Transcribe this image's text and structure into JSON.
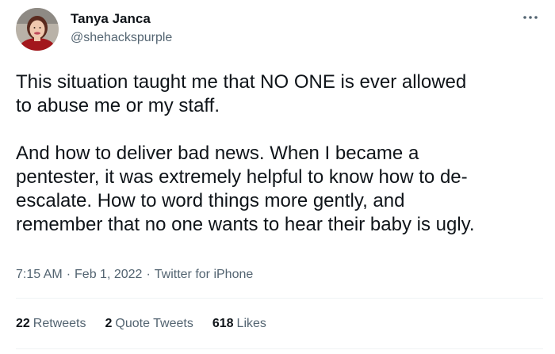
{
  "user": {
    "name": "Tanya Janca",
    "handle": "@shehackspurple"
  },
  "tweet": {
    "paragraphs": [
      [
        "This situation taught me that NO ONE is ever allowed",
        "to abuse me or my staff."
      ],
      [
        "And how to deliver bad news. When I became a",
        "pentester, it was extremely helpful to know how to de-",
        "escalate. How to word things more gently, and",
        "remember that no one wants to hear their baby is ugly."
      ]
    ]
  },
  "meta": {
    "time": "7:15 AM",
    "date": "Feb 1, 2022",
    "source": "Twitter for iPhone",
    "separator": "·"
  },
  "stats": {
    "retweets_count": "22",
    "retweets_label": "Retweets",
    "quotes_count": "2",
    "quotes_label": "Quote Tweets",
    "likes_count": "618",
    "likes_label": "Likes"
  },
  "icons": {
    "more": "more-horizontal-icon",
    "avatar": "profile-photo"
  },
  "colors": {
    "text": "#0f1419",
    "secondary": "#536471",
    "divider": "#eff3f4"
  }
}
